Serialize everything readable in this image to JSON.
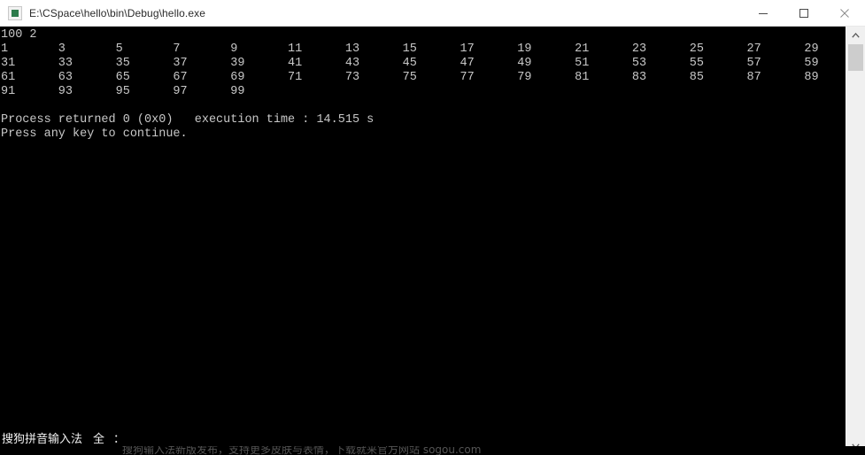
{
  "window": {
    "title": "E:\\CSpace\\hello\\bin\\Debug\\hello.exe",
    "icon": "console-app-icon",
    "controls": {
      "minimize": "minimize-button",
      "maximize": "maximize-button",
      "close": "close-button"
    },
    "titlebar_bg": "#ffffff",
    "titlebar_fg": "#2b2b2b"
  },
  "console": {
    "background": "#000000",
    "foreground": "#c8c8c8",
    "header_line": "100 2",
    "columns_per_row": 15,
    "rows": [
      [
        1,
        3,
        5,
        7,
        9,
        11,
        13,
        15,
        17,
        19,
        21,
        23,
        25,
        27,
        29
      ],
      [
        31,
        33,
        35,
        37,
        39,
        41,
        43,
        45,
        47,
        49,
        51,
        53,
        55,
        57,
        59
      ],
      [
        61,
        63,
        65,
        67,
        69,
        71,
        73,
        75,
        77,
        79,
        81,
        83,
        85,
        87,
        89
      ],
      [
        91,
        93,
        95,
        97,
        99
      ]
    ],
    "text": "100 2\n1       3       5       7       9       11      13      15      17      19      21      23      25      27      29\n31      33      35      37      39      41      43      45      47      49      51      53      55      57      59\n61      63      65      67      69      71      73      75      77      79      81      83      85      87      89\n91      93      95      97      99\n\nProcess returned 0 (0x0)   execution time : 14.515 s\nPress any key to continue.",
    "process_returned": "Process returned 0 (0x0)",
    "exit_code": "0 (0x0)",
    "execution_time": "execution time : 14.515 s",
    "execution_time_value": "14.515 s",
    "prompt": "Press any key to continue."
  },
  "scrollbar": {
    "up_arrow": "scroll-up-arrow",
    "down_arrow": "scroll-down-arrow",
    "thumb": "scroll-thumb",
    "track_color": "#f0f0f0",
    "thumb_color": "#cdcdcd"
  },
  "ime": {
    "name": "搜狗拼音输入法",
    "mode": "全",
    "separator": "：",
    "ad_text": "搜狗输入法新版发布，支持更多皮肤与表情，下载就来官方网站 sogou.com"
  }
}
